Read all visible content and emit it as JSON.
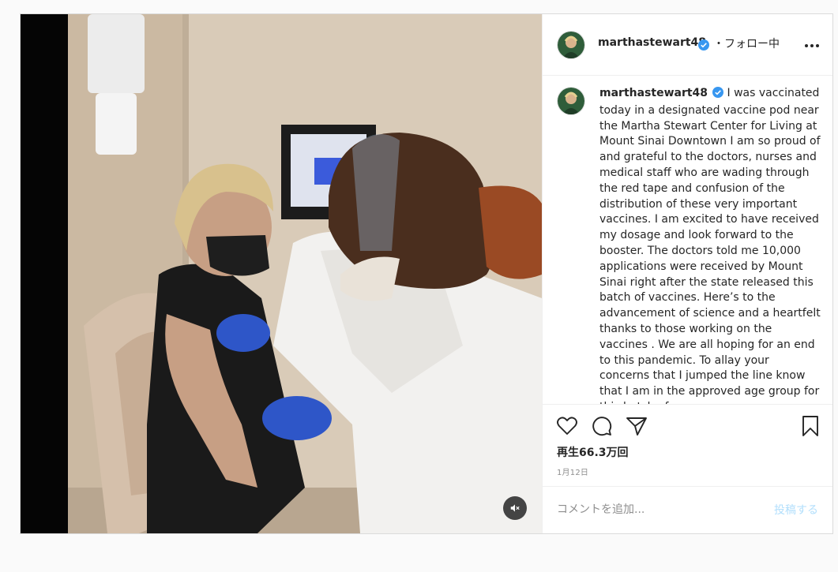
{
  "post": {
    "author": {
      "username": "marthastewart48",
      "verified": true,
      "follow_status": "・フォロー中"
    },
    "caption": "I was vaccinated today in a designated vaccine pod near the Martha Stewart Center for Living at Mount Sinai Downtown I am so proud of and grateful to the doctors, nurses and medical staff who are wading through the red tape and confusion of the distribution of these very important vaccines. I am excited to have received my dosage and look forward to the booster. The doctors told me 10,000 applications were received by Mount Sinai right after the state released this batch of vaccines. Here’s to the advancement of science and a heartfelt thanks to those working on the vaccines . We are all hoping for an end to this pandemic. To allay your concerns that I jumped the line know that I am in the approved age group for this batch of",
    "views": "再生66.3万回",
    "date": "1月12日",
    "video_muted": true
  },
  "icons": {
    "more": "more-horizontal-icon",
    "like": "heart-icon",
    "comment": "comment-bubble-icon",
    "share": "paper-plane-icon",
    "save": "bookmark-icon",
    "mute": "speaker-muted-icon",
    "verified": "verified-badge-icon"
  },
  "comment_box": {
    "placeholder": "コメントを追加...",
    "post_label": "投稿する"
  },
  "colors": {
    "verified_blue": "#3897f0",
    "post_button_disabled": "#b2dffc",
    "border": "#dbdbdb",
    "page_background": "#fafafa"
  }
}
